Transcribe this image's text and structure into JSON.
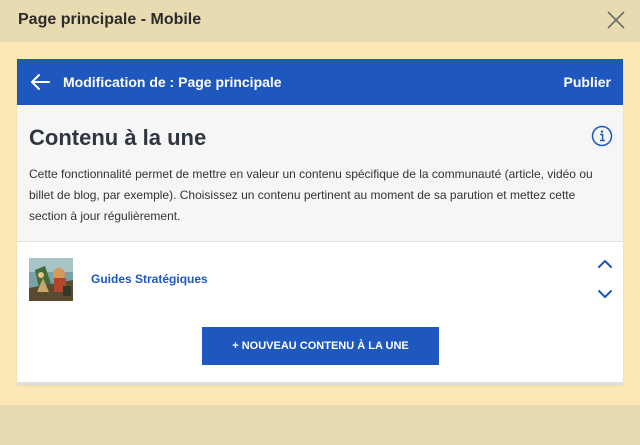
{
  "window": {
    "title": "Page principale - Mobile"
  },
  "topbar": {
    "title": "Modification de : Page principale",
    "publish_label": "Publier"
  },
  "section": {
    "title": "Contenu à la une",
    "description": "Cette fonctionnalité permet de mettre en valeur un contenu spécifique de la communauté (article, vidéo ou billet de blog, par exemple). Choisissez un contenu pertinent au moment de sa parution et mettez cette section à jour régulièrement."
  },
  "item": {
    "label": "Guides Stratégiques"
  },
  "add_button": {
    "label": "+ NOUVEAU CONTENU À LA UNE"
  },
  "icons": [
    "close-icon",
    "back-arrow-icon",
    "info-icon",
    "chevron-up-icon",
    "chevron-down-icon"
  ],
  "colors": {
    "accent": "#1e58be",
    "backdrop": "#fbe8b5",
    "header": "#e9dbb1"
  }
}
